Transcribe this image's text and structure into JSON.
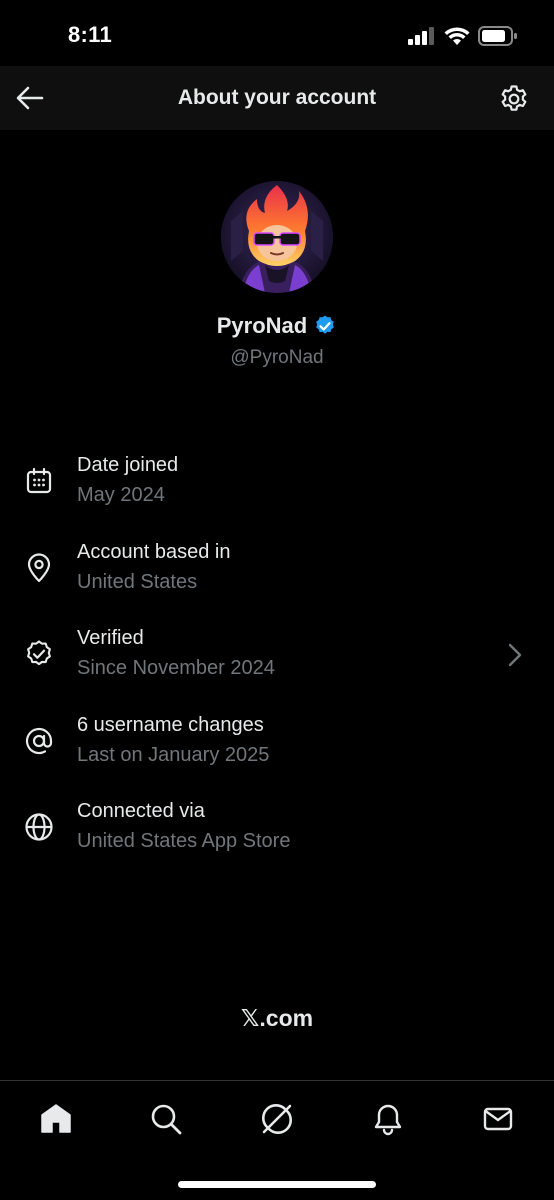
{
  "status_bar": {
    "time": "8:11"
  },
  "header": {
    "title": "About your account"
  },
  "profile": {
    "display_name": "PyroNad",
    "handle": "@PyroNad",
    "verified": true,
    "badge_color": "#1d9bf0"
  },
  "info_items": [
    {
      "icon": "calendar-icon",
      "title": "Date joined",
      "subtitle": "May 2024"
    },
    {
      "icon": "location-pin-icon",
      "title": "Account based in",
      "subtitle": "United States"
    },
    {
      "icon": "verified-badge-icon",
      "title": "Verified",
      "subtitle": "Since November 2024",
      "has_chevron": true
    },
    {
      "icon": "at-sign-icon",
      "title": "6 username changes",
      "subtitle": "Last on January 2025"
    },
    {
      "icon": "globe-icon",
      "title": "Connected via",
      "subtitle": "United States App Store"
    }
  ],
  "footer": {
    "link": "𝕏.com"
  },
  "tab_bar": {
    "tabs": [
      "home-icon",
      "search-icon",
      "grok-icon",
      "notifications-bell-icon",
      "messages-envelope-icon"
    ],
    "active": "home-icon"
  },
  "colors": {
    "background": "#000000",
    "header_bg": "#0f0f0f",
    "primary_text": "#e7e9ea",
    "secondary_text": "#71767b",
    "verified_blue": "#1d9bf0"
  }
}
